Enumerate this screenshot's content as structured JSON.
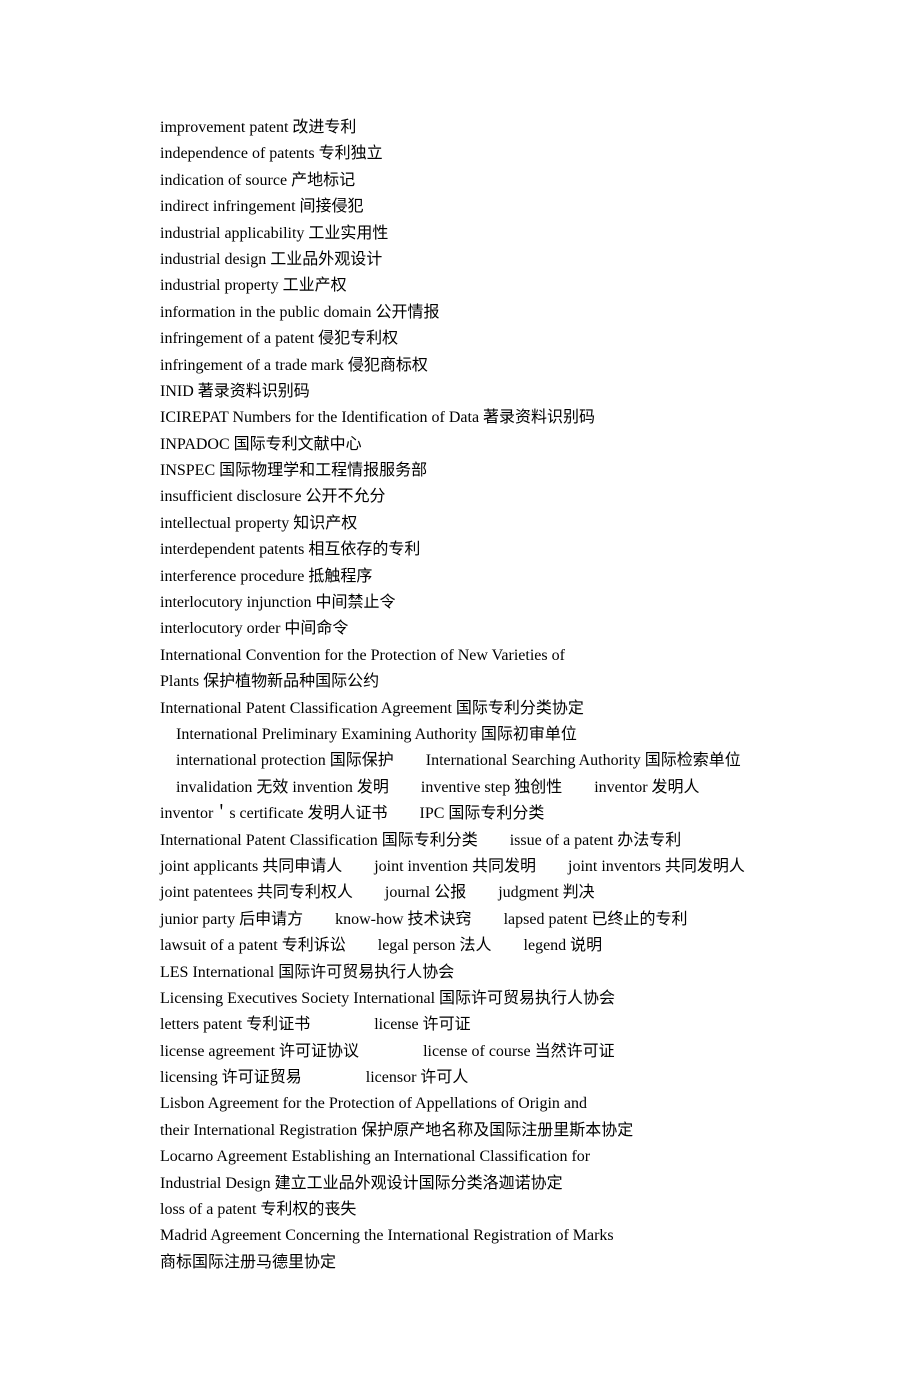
{
  "lines": [
    {
      "indent": false,
      "segments": [
        "improvement patent  改进专利"
      ]
    },
    {
      "indent": false,
      "segments": [
        "independence of patents  专利独立"
      ]
    },
    {
      "indent": false,
      "segments": [
        "indication of source  产地标记"
      ]
    },
    {
      "indent": false,
      "segments": [
        "indirect infringement  间接侵犯"
      ]
    },
    {
      "indent": false,
      "segments": [
        "industrial applicability  工业实用性"
      ]
    },
    {
      "indent": false,
      "segments": [
        "industrial design  工业品外观设计"
      ]
    },
    {
      "indent": false,
      "segments": [
        "industrial property  工业产权"
      ]
    },
    {
      "indent": false,
      "segments": [
        "information in the public domain  公开情报"
      ]
    },
    {
      "indent": false,
      "segments": [
        "infringement of a patent  侵犯专利权"
      ]
    },
    {
      "indent": false,
      "segments": [
        "infringement of a trade mark  侵犯商标权"
      ]
    },
    {
      "indent": false,
      "segments": [
        "INID  著录资料识别码"
      ]
    },
    {
      "indent": false,
      "segments": [
        "ICIREPAT Numbers for the Identification of Data  著录资料识别码"
      ]
    },
    {
      "indent": false,
      "segments": [
        "INPADOC  国际专利文献中心"
      ]
    },
    {
      "indent": false,
      "segments": [
        "INSPEC  国际物理学和工程情报服务部"
      ]
    },
    {
      "indent": false,
      "segments": [
        "insufficient disclosure  公开不允分"
      ]
    },
    {
      "indent": false,
      "segments": [
        "intellectual property  知识产权"
      ]
    },
    {
      "indent": false,
      "segments": [
        "interdependent patents  相互依存的专利"
      ]
    },
    {
      "indent": false,
      "segments": [
        "interference procedure  抵触程序"
      ]
    },
    {
      "indent": false,
      "segments": [
        "interlocutory injunction  中间禁止令"
      ]
    },
    {
      "indent": false,
      "segments": [
        "interlocutory order  中间命令"
      ]
    },
    {
      "indent": false,
      "segments": [
        "International Convention for the Protection of New Varieties of"
      ]
    },
    {
      "indent": false,
      "segments": [
        "Plants  保护植物新品种国际公约"
      ]
    },
    {
      "indent": false,
      "segments": [
        "International Patent Classification Agreement  国际专利分类协定"
      ]
    },
    {
      "indent": true,
      "segments": [
        "International Preliminary Examining Authority  国际初审单位"
      ]
    },
    {
      "indent": true,
      "segments": [
        "international protection  国际保护",
        "International Searching Authority  国际检索单位"
      ],
      "sep": "sep"
    },
    {
      "indent": true,
      "segments": [
        "invalidation  无效 invention  发明",
        "inventive step  独创性",
        "inventor  发明人"
      ],
      "sep": "sep"
    },
    {
      "indent": false,
      "segments": [
        "inventor＇s certificate  发明人证书",
        "IPC  国际专利分类"
      ],
      "sep": "sep"
    },
    {
      "indent": false,
      "segments": [
        "International Patent Classification  国际专利分类",
        "issue of a patent  办法专利"
      ],
      "sep": "sep"
    },
    {
      "indent": false,
      "segments": [
        "joint applicants  共同申请人",
        "joint invention  共同发明",
        "joint inventors  共同发明人"
      ],
      "sep": "sep"
    },
    {
      "indent": false,
      "segments": [
        "joint patentees  共同专利权人",
        "journal  公报",
        "judgment  判决"
      ],
      "sep": "sep"
    },
    {
      "indent": false,
      "segments": [
        "junior party  后申请方",
        "know-how  技术诀窍",
        "lapsed patent  已终止的专利"
      ],
      "sep": "sep"
    },
    {
      "indent": false,
      "segments": [
        "lawsuit of a patent  专利诉讼",
        "legal person  法人",
        "legend  说明"
      ],
      "sep": "sep"
    },
    {
      "indent": false,
      "segments": [
        "LES International  国际许可贸易执行人协会"
      ]
    },
    {
      "indent": false,
      "segments": [
        "Licensing Executives Society International  国际许可贸易执行人协会"
      ]
    },
    {
      "indent": false,
      "segments": [
        "letters patent  专利证书",
        "license  许可证"
      ],
      "sep": "sep-wide"
    },
    {
      "indent": false,
      "segments": [
        "license agreement  许可证协议",
        "license of course  当然许可证"
      ],
      "sep": "sep-wide"
    },
    {
      "indent": false,
      "segments": [
        "licensing  许可证贸易",
        "licensor  许可人"
      ],
      "sep": "sep-wide"
    },
    {
      "indent": false,
      "segments": [
        "Lisbon Agreement for the Protection of Appellations of Origin and"
      ]
    },
    {
      "indent": false,
      "segments": [
        "their International Registration  保护原产地名称及国际注册里斯本协定"
      ]
    },
    {
      "indent": false,
      "segments": [
        "Locarno Agreement Establishing an International Classification for"
      ]
    },
    {
      "indent": false,
      "segments": [
        "Industrial Design  建立工业品外观设计国际分类洛迦诺协定"
      ]
    },
    {
      "indent": false,
      "segments": [
        "loss of a patent  专利权的丧失"
      ]
    },
    {
      "indent": false,
      "segments": [
        "Madrid Agreement Concerning the International Registration of Marks"
      ]
    },
    {
      "indent": false,
      "segments": [
        "商标国际注册马德里协定"
      ]
    }
  ]
}
